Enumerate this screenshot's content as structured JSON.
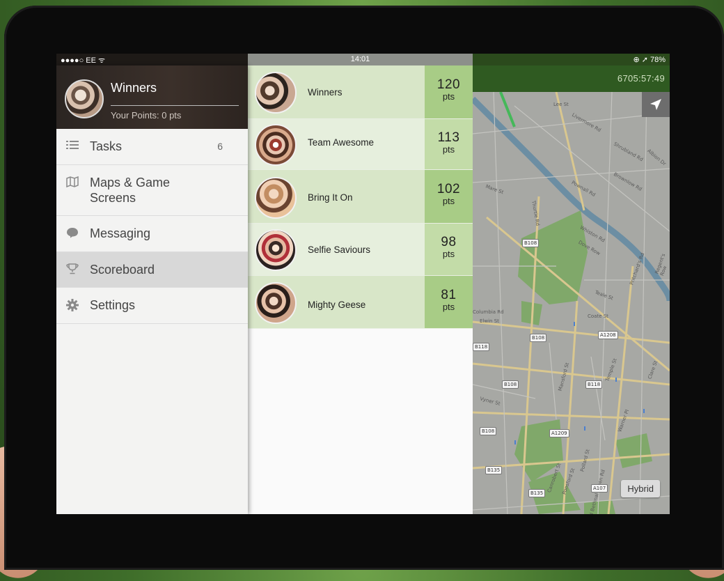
{
  "status_bar": {
    "carrier": "●●●●○ EE ᯤ",
    "time": "14:01",
    "battery": "⊕ ➚ 78%"
  },
  "profile": {
    "name": "Winners",
    "points_text": "Your Points: 0 pts"
  },
  "menu": {
    "tasks": {
      "label": "Tasks",
      "count": "6",
      "icon": "list-icon"
    },
    "maps": {
      "label_line1": "Maps & Game",
      "label_line2": "Screens",
      "icon": "map-icon"
    },
    "messaging": {
      "label": "Messaging",
      "icon": "speech-bubble-icon"
    },
    "scoreboard": {
      "label": "Scoreboard",
      "icon": "trophy-icon"
    },
    "settings": {
      "label": "Settings",
      "icon": "gear-icon"
    }
  },
  "scoreboard": {
    "teams": [
      {
        "name": "Winners",
        "points": "120",
        "unit": "pts"
      },
      {
        "name": "Team Awesome",
        "points": "113",
        "unit": "pts"
      },
      {
        "name": "Bring It On",
        "points": "102",
        "unit": "pts"
      },
      {
        "name": "Selfie Saviours",
        "points": "98",
        "unit": "pts"
      },
      {
        "name": "Mighty Geese",
        "points": "81",
        "unit": "pts"
      }
    ]
  },
  "map": {
    "timer": "6705:57:49",
    "hybrid_label": "Hybrid",
    "road_labels": [
      "Lee St",
      "Livermore Rd",
      "Shrubland Rd",
      "Albion Dr",
      "Brownlow Rd",
      "Pownall Rd",
      "Mare St",
      "Thurtle Rd",
      "Whiston Rd",
      "Dove Row",
      "Pritchard's Rd",
      "Teale St",
      "Coate St",
      "Columbia Rd",
      "Elwin St",
      "Temple St",
      "Mansford St",
      "Clare St",
      "Warner Pl",
      "Canrobert St",
      "Ponsford St",
      "Vyner St",
      "Regent's Row",
      "Pollard St",
      "Old Bethnal Green Rd"
    ],
    "road_shields": [
      "B108",
      "B108",
      "A1208",
      "B118",
      "B108",
      "B118",
      "B108",
      "A1209",
      "B135",
      "B135",
      "A107"
    ]
  },
  "colors": {
    "accent_green": "#2f5a21",
    "row_dark": "#d8e6c8",
    "row_light": "#e6efdd",
    "pts_dark": "#a8cc86",
    "pts_light": "#c3dca8"
  }
}
